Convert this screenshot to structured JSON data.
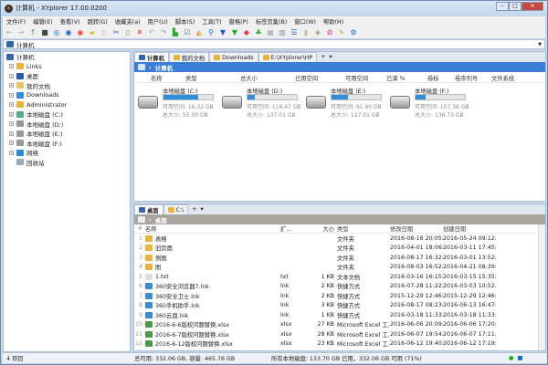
{
  "window": {
    "title": "计算机 - XYplorer 17.00.0200",
    "minimize": "–",
    "maximize": "□",
    "close": "✕"
  },
  "menu": [
    "文件(F)",
    "编辑(E)",
    "查看(V)",
    "跳转(G)",
    "收藏夹(a)",
    "用户(U)",
    "脚本(S)",
    "工具(T)",
    "窗格(P)",
    "标签页集(B)",
    "窗口(W)",
    "帮助(H)"
  ],
  "toolbar": [
    {
      "icon": "back-icon",
      "glyph": "←",
      "color": "#9aa"
    },
    {
      "icon": "forward-icon",
      "glyph": "→",
      "color": "#9aa"
    },
    {
      "icon": "up-icon",
      "glyph": "↑",
      "color": "#2a2"
    },
    {
      "icon": "computer-icon",
      "glyph": "■",
      "color": "#444"
    },
    {
      "icon": "target-icon",
      "glyph": "◎",
      "color": "#16c"
    },
    {
      "icon": "search-circle-icon",
      "glyph": "◉",
      "color": "#16c"
    },
    {
      "icon": "next-circle-icon",
      "glyph": "◉",
      "color": "#e43"
    },
    {
      "icon": "new-folder-icon",
      "glyph": "▰",
      "color": "#db3"
    },
    {
      "icon": "copy-icon",
      "glyph": "▯",
      "color": "#aaa"
    },
    {
      "icon": "cut-icon",
      "glyph": "✂",
      "color": "#36a"
    },
    {
      "icon": "paste-icon",
      "glyph": "▯",
      "color": "#a86"
    },
    {
      "icon": "delete-icon",
      "glyph": "✕",
      "color": "#d22"
    },
    {
      "icon": "undo-icon",
      "glyph": "↶",
      "color": "#9aa"
    },
    {
      "icon": "redo-icon",
      "glyph": "↷",
      "color": "#9aa"
    },
    {
      "icon": "tree-toggle-icon",
      "glyph": "▙",
      "color": "#3a3"
    },
    {
      "icon": "checkbox-icon",
      "glyph": "☑",
      "color": "#579"
    },
    {
      "icon": "pie-icon",
      "glyph": "◭",
      "color": "#e80"
    },
    {
      "icon": "find-icon",
      "glyph": "⚲",
      "color": "#16c"
    },
    {
      "icon": "filter-icon",
      "glyph": "▼",
      "color": "#16c"
    },
    {
      "icon": "filter-green-icon",
      "glyph": "▼",
      "color": "#2a2"
    },
    {
      "icon": "tag-icon",
      "glyph": "◆",
      "color": "#e34"
    },
    {
      "icon": "tree-icon",
      "glyph": "♣",
      "color": "#3a3"
    },
    {
      "icon": "grid-icon",
      "glyph": "▦",
      "color": "#aaa"
    },
    {
      "icon": "columns-icon",
      "glyph": "▥",
      "color": "#79a"
    },
    {
      "icon": "dual-pane-icon",
      "glyph": "☰",
      "color": "#36a"
    },
    {
      "icon": "panel-icon",
      "glyph": "▮",
      "color": "#cb9"
    },
    {
      "icon": "tag-label-icon",
      "glyph": "◈",
      "color": "#a98"
    },
    {
      "icon": "color-icon",
      "glyph": "✿",
      "color": "#e5a"
    },
    {
      "icon": "brush-icon",
      "glyph": "✎",
      "color": "#ca3"
    },
    {
      "icon": "settings-icon",
      "glyph": "⚙",
      "color": "#16c"
    }
  ],
  "address": {
    "value": "计算机"
  },
  "tree": [
    {
      "label": "计算机",
      "icon": "computer-icon",
      "color": "#36a",
      "root": true
    },
    {
      "label": "Links",
      "icon": "links-folder-icon",
      "color": "#e9b43a"
    },
    {
      "label": "桌面",
      "icon": "desktop-icon",
      "color": "#2a5aa8"
    },
    {
      "label": "我的文档",
      "icon": "documents-folder-icon",
      "color": "#e9c46a"
    },
    {
      "label": "Downloads",
      "icon": "downloads-folder-icon",
      "color": "#3a8ad8"
    },
    {
      "label": "Administrator",
      "icon": "user-folder-icon",
      "color": "#e9b43a"
    },
    {
      "label": "本地磁盘 (C:)",
      "icon": "system-drive-icon",
      "color": "#5a8"
    },
    {
      "label": "本地磁盘 (D:)",
      "icon": "drive-icon",
      "color": "#999"
    },
    {
      "label": "本地磁盘 (E:)",
      "icon": "drive-icon",
      "color": "#999"
    },
    {
      "label": "本地磁盘 (F:)",
      "icon": "drive-icon",
      "color": "#999"
    },
    {
      "label": "网络",
      "icon": "network-icon",
      "color": "#2a8ad8"
    },
    {
      "label": "回收站",
      "icon": "recycle-bin-icon",
      "color": "#9ab",
      "noexp": true
    }
  ],
  "top_pane": {
    "tabs": [
      {
        "label": "计算机",
        "active": true
      },
      {
        "label": "我的文档"
      },
      {
        "label": "Downloads"
      },
      {
        "label": "E:\\XYplorer\\HP"
      }
    ],
    "add_tab": "+",
    "tab_menu": "▾",
    "breadcrumb": [
      "计算机"
    ],
    "crumb_color": "#3a7fd5",
    "columns": [
      "名称",
      "类型",
      "总大小",
      "已用空间",
      "可用空间",
      "已满 %",
      "卷标",
      "卷序列号",
      "文件系统"
    ],
    "drives": [
      {
        "name": "本地磁盘 (C:)",
        "free": "可用空间: 16.32 GB",
        "total": "总大小: 55.00 GB",
        "used_pct": 70
      },
      {
        "name": "本地磁盘 (D:)",
        "free": "可用空间: 116.47 GB",
        "total": "总大小: 137.01 GB",
        "used_pct": 15
      },
      {
        "name": "本地磁盘 (E:)",
        "free": "可用空间: 91.90 GB",
        "total": "总大小: 137.01 GB",
        "used_pct": 33
      },
      {
        "name": "本地磁盘 (F:)",
        "free": "可用空间: 107.36 GB",
        "total": "总大小: 136.73 GB",
        "used_pct": 21
      }
    ]
  },
  "bottom_pane": {
    "tabs": [
      {
        "label": "桌面",
        "active": true
      },
      {
        "label": "C:\\"
      }
    ],
    "add_tab": "+",
    "tab_menu": "▾",
    "breadcrumb": [
      "桌面"
    ],
    "crumb_color": "#a9a6a0",
    "columns": [
      "#",
      "名称",
      "扩...",
      "大小",
      "类型",
      "修改日期",
      "创建日期"
    ],
    "rows": [
      {
        "n": "1",
        "name": "表格",
        "ext": "",
        "size": "",
        "type": "文件夹",
        "modified": "2016-08-16 20:05:17",
        "created": "2016-05-24 09:12:28",
        "icon": "folder-icon"
      },
      {
        "n": "2",
        "name": "旧页面",
        "ext": "",
        "size": "",
        "type": "文件夹",
        "modified": "2016-04-01 18:06:09",
        "created": "2016-03-11 17:45:50",
        "icon": "folder-icon"
      },
      {
        "n": "3",
        "name": "例图",
        "ext": "",
        "size": "",
        "type": "文件夹",
        "modified": "2016-08-17 16:32:42",
        "created": "2016-03-01 13:52:48",
        "icon": "folder-icon"
      },
      {
        "n": "4",
        "name": "图",
        "ext": "",
        "size": "",
        "type": "文件夹",
        "modified": "2016-08-03 16:52:59",
        "created": "2016-04-21 08:39:50",
        "icon": "folder-icon"
      },
      {
        "n": "5",
        "name": "1.txt",
        "ext": "txt",
        "size": "1 KB",
        "type": "文本文档",
        "modified": "2016-03-16 16:15:18",
        "created": "2016-03-15 15:35:31",
        "icon": "text-file-icon"
      },
      {
        "n": "6",
        "name": "360安全浏览器7.lnk",
        "ext": "lnk",
        "size": "2 KB",
        "type": "快捷方式",
        "modified": "2016-07-28 11:22:10",
        "created": "2016-03-03 10:52:11",
        "icon": "shortcut-icon"
      },
      {
        "n": "7",
        "name": "360安全卫士.lnk",
        "ext": "lnk",
        "size": "2 KB",
        "type": "快捷方式",
        "modified": "2015-12-29 12:46:00",
        "created": "2015-12-29 12:46:00",
        "icon": "shortcut-icon"
      },
      {
        "n": "8",
        "name": "360手机助手.lnk",
        "ext": "lnk",
        "size": "3 KB",
        "type": "快捷方式",
        "modified": "2016-08-17 08:23:01",
        "created": "2016-06-13 16:47:23",
        "icon": "shortcut-icon"
      },
      {
        "n": "9",
        "name": "360云盘.lnk",
        "ext": "lnk",
        "size": "1 KB",
        "type": "快捷方式",
        "modified": "2016-03-18 11:33:43",
        "created": "2016-03-18 11:33:43",
        "icon": "shortcut-icon"
      },
      {
        "n": "10",
        "name": "2016-6-6版权问题替换.xlsx",
        "ext": "xlsx",
        "size": "27 KB",
        "type": "Microsoft Excel 工...",
        "modified": "2016-06-06 20:09:51",
        "created": "2016-06-06 17:20:11",
        "icon": "excel-file-icon"
      },
      {
        "n": "11",
        "name": "2016-6-7版权问题替换.xlsx",
        "ext": "xlsx",
        "size": "28 KB",
        "type": "Microsoft Excel 工...",
        "modified": "2016-06-07 19:54:56",
        "created": "2016-06-07 17:11:57",
        "icon": "excel-file-icon"
      },
      {
        "n": "12",
        "name": "2016-6-12版权问题替换.xlsx",
        "ext": "xlsx",
        "size": "23 KB",
        "type": "Microsoft Excel 工...",
        "modified": "2016-06-12 19:40:37",
        "created": "2016-06-12 17:19:10",
        "icon": "excel-file-icon"
      }
    ]
  },
  "status": {
    "items": "4 项目",
    "capacity": "总可用: 332.06 GB, 容量: 465.76 GB",
    "drives": "所有本地磁盘: 133.70 GB 已用，332.06 GB 可用 (71%)"
  }
}
